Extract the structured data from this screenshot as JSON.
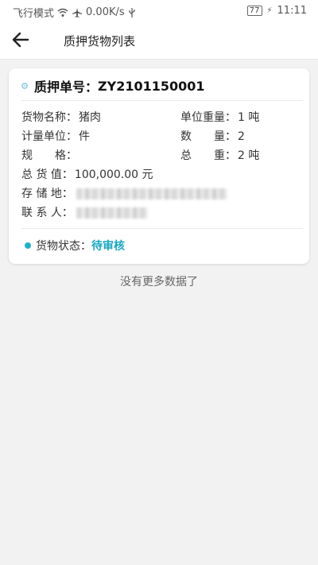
{
  "status_bar": {
    "carrier": "飞行模式",
    "speed": "0.00K/s",
    "battery": "77",
    "time": "11:11"
  },
  "header": {
    "title": "质押货物列表"
  },
  "card": {
    "order_label": "质押单号：",
    "order_no": "ZY2101150001",
    "fields": {
      "goods_name_label": "货物名称：",
      "goods_name": "猪肉",
      "unit_weight_label": "单位重量：",
      "unit_weight": "1 吨",
      "measure_unit_label": "计量单位：",
      "measure_unit": "件",
      "quantity_label": "数　　量：",
      "quantity": "2",
      "spec_label": "规　　格：",
      "spec": "",
      "total_weight_label": "总　　重：",
      "total_weight": "2 吨",
      "total_value_label": "总 货 值：",
      "total_value": "100,000.00 元",
      "storage_label": "存 储 地：",
      "contact_label": "联 系 人："
    },
    "status_label": "货物状态：",
    "status_value": "待审核"
  },
  "footer": {
    "no_more": "没有更多数据了"
  },
  "colors": {
    "accent": "#19a8c0",
    "background": "#f2f2f2"
  }
}
